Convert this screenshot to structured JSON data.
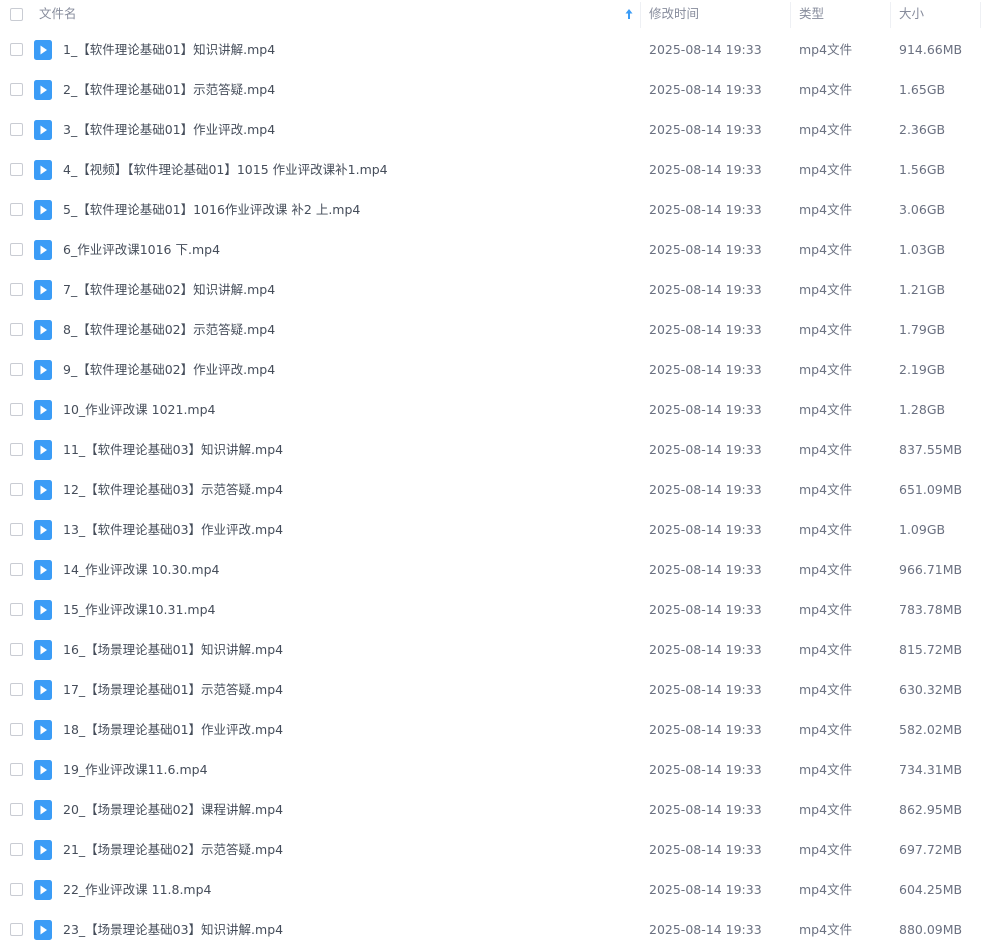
{
  "header": {
    "name_label": "文件名",
    "date_label": "修改时间",
    "type_label": "类型",
    "size_label": "大小",
    "sort_icon": "arrow-up-icon"
  },
  "colors": {
    "accent": "#3b9cf6",
    "header_text": "#878c9c"
  },
  "rows": [
    {
      "name": "1_【软件理论基础01】知识讲解.mp4",
      "date": "2025-08-14 19:33",
      "type": "mp4文件",
      "size": "914.66MB"
    },
    {
      "name": "2_【软件理论基础01】示范答疑.mp4",
      "date": "2025-08-14 19:33",
      "type": "mp4文件",
      "size": "1.65GB"
    },
    {
      "name": "3_【软件理论基础01】作业评改.mp4",
      "date": "2025-08-14 19:33",
      "type": "mp4文件",
      "size": "2.36GB"
    },
    {
      "name": "4_【视频】【软件理论基础01】1015 作业评改课补1.mp4",
      "date": "2025-08-14 19:33",
      "type": "mp4文件",
      "size": "1.56GB"
    },
    {
      "name": "5_【软件理论基础01】1016作业评改课 补2 上.mp4",
      "date": "2025-08-14 19:33",
      "type": "mp4文件",
      "size": "3.06GB"
    },
    {
      "name": "6_作业评改课1016 下.mp4",
      "date": "2025-08-14 19:33",
      "type": "mp4文件",
      "size": "1.03GB"
    },
    {
      "name": "7_【软件理论基础02】知识讲解.mp4",
      "date": "2025-08-14 19:33",
      "type": "mp4文件",
      "size": "1.21GB"
    },
    {
      "name": "8_【软件理论基础02】示范答疑.mp4",
      "date": "2025-08-14 19:33",
      "type": "mp4文件",
      "size": "1.79GB"
    },
    {
      "name": "9_【软件理论基础02】作业评改.mp4",
      "date": "2025-08-14 19:33",
      "type": "mp4文件",
      "size": "2.19GB"
    },
    {
      "name": "10_作业评改课 1021.mp4",
      "date": "2025-08-14 19:33",
      "type": "mp4文件",
      "size": "1.28GB"
    },
    {
      "name": "11_【软件理论基础03】知识讲解.mp4",
      "date": "2025-08-14 19:33",
      "type": "mp4文件",
      "size": "837.55MB"
    },
    {
      "name": "12_【软件理论基础03】示范答疑.mp4",
      "date": "2025-08-14 19:33",
      "type": "mp4文件",
      "size": "651.09MB"
    },
    {
      "name": "13_【软件理论基础03】作业评改.mp4",
      "date": "2025-08-14 19:33",
      "type": "mp4文件",
      "size": "1.09GB"
    },
    {
      "name": "14_作业评改课 10.30.mp4",
      "date": "2025-08-14 19:33",
      "type": "mp4文件",
      "size": "966.71MB"
    },
    {
      "name": "15_作业评改课10.31.mp4",
      "date": "2025-08-14 19:33",
      "type": "mp4文件",
      "size": "783.78MB"
    },
    {
      "name": "16_【场景理论基础01】知识讲解.mp4",
      "date": "2025-08-14 19:33",
      "type": "mp4文件",
      "size": "815.72MB"
    },
    {
      "name": "17_【场景理论基础01】示范答疑.mp4",
      "date": "2025-08-14 19:33",
      "type": "mp4文件",
      "size": "630.32MB"
    },
    {
      "name": "18_【场景理论基础01】作业评改.mp4",
      "date": "2025-08-14 19:33",
      "type": "mp4文件",
      "size": "582.02MB"
    },
    {
      "name": "19_作业评改课11.6.mp4",
      "date": "2025-08-14 19:33",
      "type": "mp4文件",
      "size": "734.31MB"
    },
    {
      "name": "20_【场景理论基础02】课程讲解.mp4",
      "date": "2025-08-14 19:33",
      "type": "mp4文件",
      "size": "862.95MB"
    },
    {
      "name": "21_【场景理论基础02】示范答疑.mp4",
      "date": "2025-08-14 19:33",
      "type": "mp4文件",
      "size": "697.72MB"
    },
    {
      "name": "22_作业评改课 11.8.mp4",
      "date": "2025-08-14 19:33",
      "type": "mp4文件",
      "size": "604.25MB"
    },
    {
      "name": "23_【场景理论基础03】知识讲解.mp4",
      "date": "2025-08-14 19:33",
      "type": "mp4文件",
      "size": "880.09MB"
    }
  ]
}
